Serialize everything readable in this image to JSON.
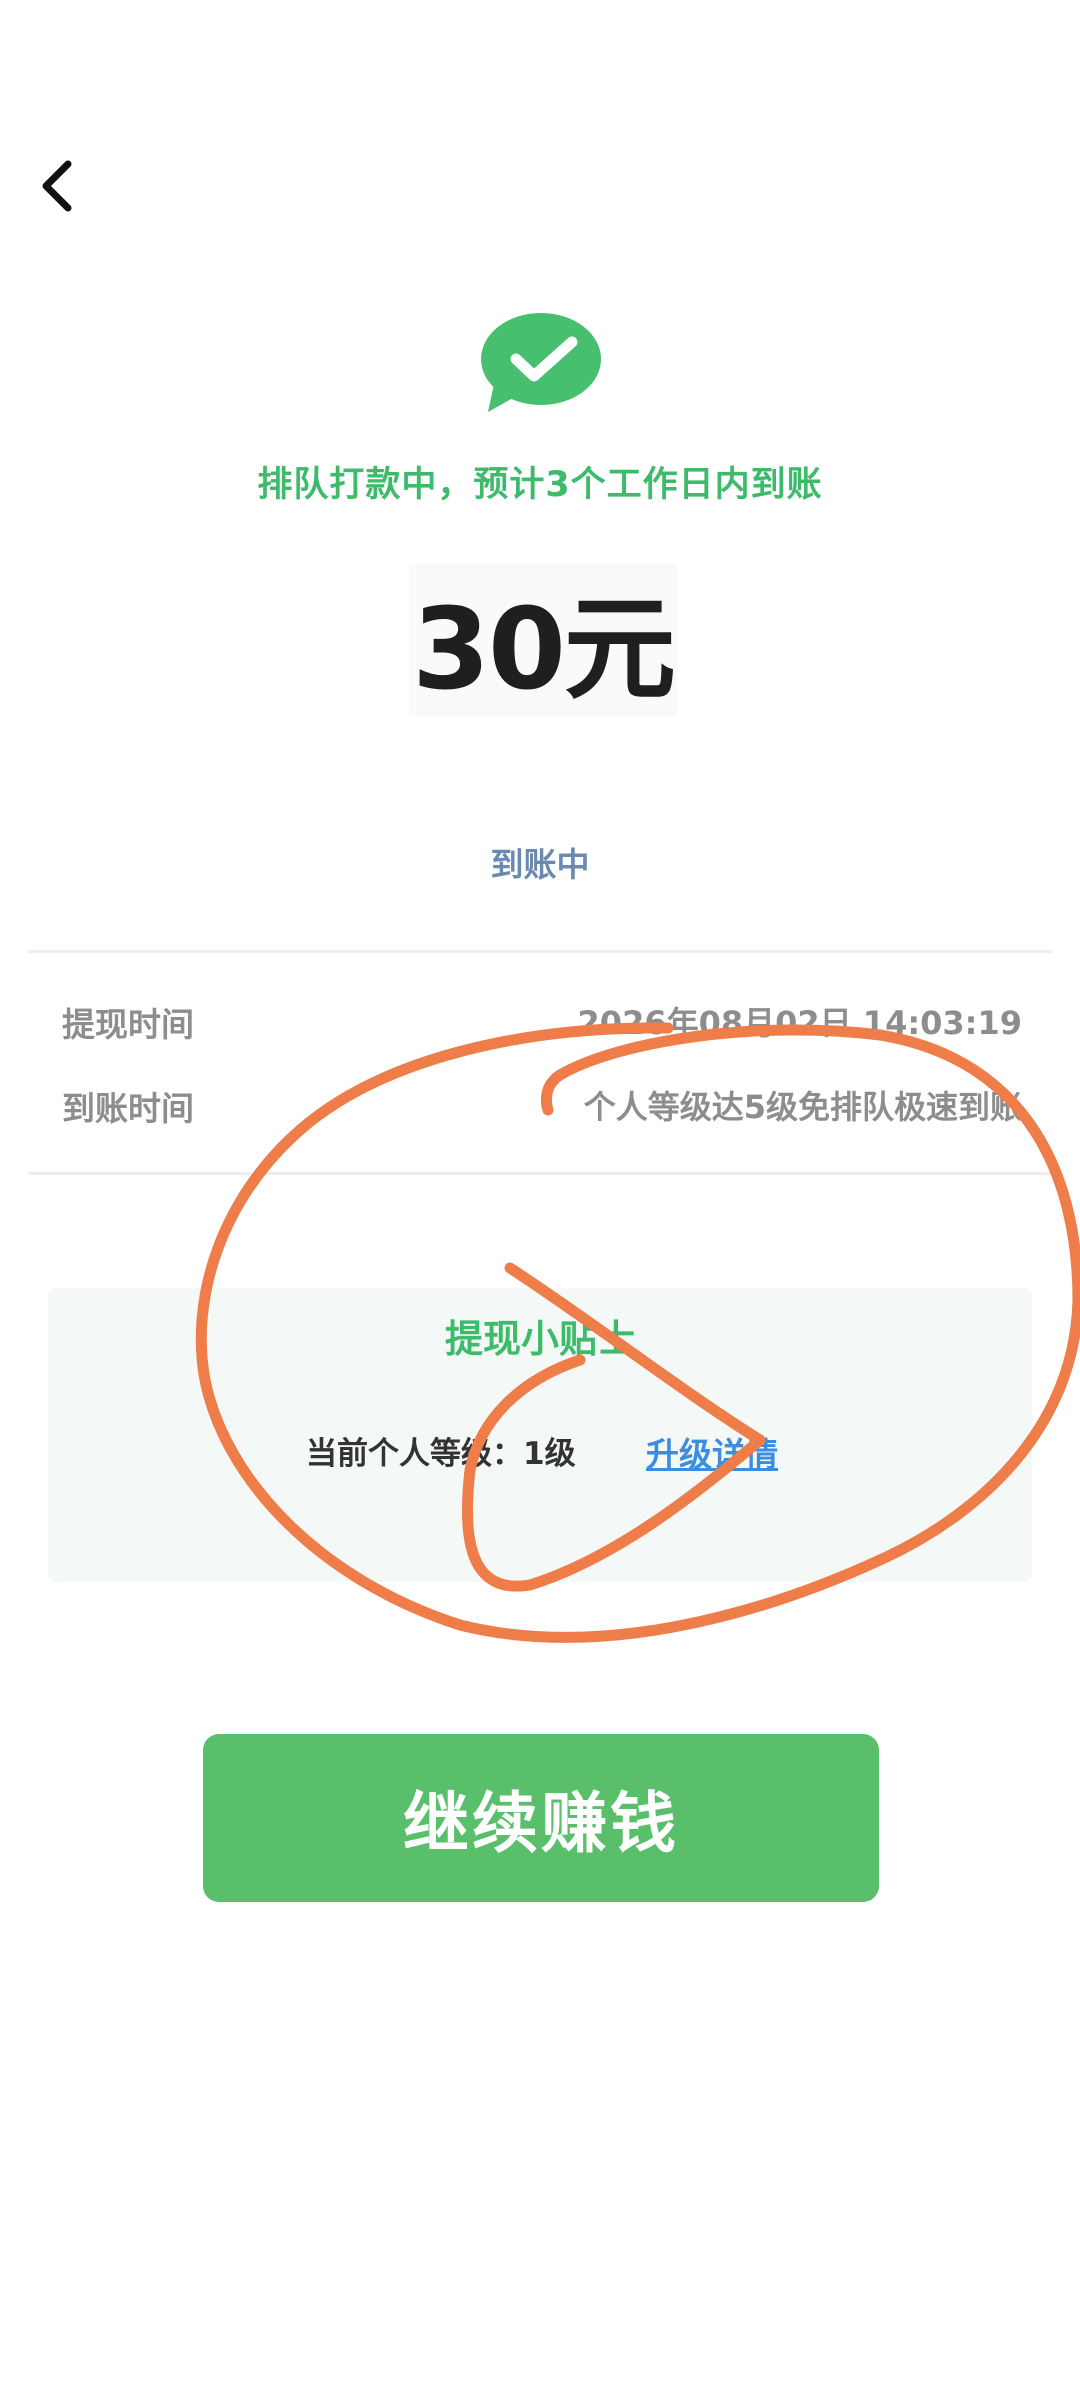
{
  "header": {
    "back_icon": "chevron-left-icon"
  },
  "status": {
    "icon": "wechat-check-icon",
    "message": "排队打款中，预计3个工作日内到账",
    "amount": "30元",
    "arrival_state": "到账中"
  },
  "details": {
    "rows": [
      {
        "label": "提现时间",
        "value": "2026年08月02日 14:03:19"
      },
      {
        "label": "到账时间",
        "value": "个人等级达5级免排队极速到账"
      }
    ]
  },
  "tips": {
    "title": "提现小贴士",
    "current_level": "当前个人等级：1级",
    "upgrade_link": "升级详情"
  },
  "actions": {
    "continue_label": "继续赚钱"
  },
  "colors": {
    "brand_green": "#3dbb6b",
    "button_green": "#59bf6a",
    "link_blue": "#3a8de0",
    "state_blue": "#6b8ab0",
    "annotation_orange": "#ef7d4a"
  }
}
